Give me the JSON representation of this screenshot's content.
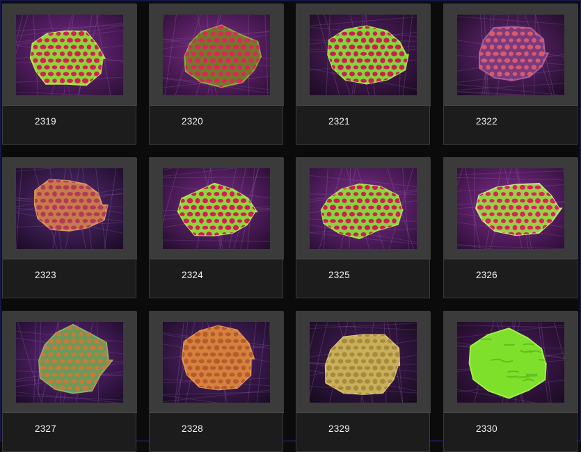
{
  "gallery": {
    "items": [
      {
        "label": "2319",
        "coral": {
          "base": "#8fd43a",
          "spot": "#d41f55",
          "rim": "#b8e44c",
          "bg": "#2a0f33",
          "tint": "#7a2a8c"
        }
      },
      {
        "label": "2320",
        "coral": {
          "base": "#6f7a2a",
          "spot": "#e2245a",
          "rim": "#98a640",
          "bg": "#2b0e34",
          "tint": "#82308e"
        }
      },
      {
        "label": "2321",
        "coral": {
          "base": "#84d43e",
          "spot": "#cc1d50",
          "rim": "#a8e24a",
          "bg": "#1a0b20",
          "tint": "#5e2270"
        }
      },
      {
        "label": "2322",
        "coral": {
          "base": "#7a3a7e",
          "spot": "#d85a6e",
          "rim": "#a35f98",
          "bg": "#1c0b24",
          "tint": "#6a2a7a"
        }
      },
      {
        "label": "2323",
        "coral": {
          "base": "#c87a4a",
          "spot": "#b13a5a",
          "rim": "#d89662",
          "bg": "#1a0a24",
          "tint": "#5a2e78"
        }
      },
      {
        "label": "2324",
        "coral": {
          "base": "#8ed63c",
          "spot": "#d21d55",
          "rim": "#b0e64c",
          "bg": "#220c2c",
          "tint": "#7c2d8a"
        }
      },
      {
        "label": "2325",
        "coral": {
          "base": "#88d43e",
          "spot": "#cf1e52",
          "rim": "#a9e14a",
          "bg": "#2a0f35",
          "tint": "#853094"
        }
      },
      {
        "label": "2326",
        "coral": {
          "base": "#9ad048",
          "spot": "#d82557",
          "rim": "#c3e682",
          "bg": "#2a0e33",
          "tint": "#872f94"
        }
      },
      {
        "label": "2327",
        "coral": {
          "base": "#6a9a58",
          "spot": "#c87a3a",
          "rim": "#8bb06a",
          "bg": "#1a0b26",
          "tint": "#6b2b86"
        }
      },
      {
        "label": "2328",
        "coral": {
          "base": "#d4823e",
          "spot": "#b85a2c",
          "rim": "#e29550",
          "bg": "#1a0b24",
          "tint": "#5a2874"
        }
      },
      {
        "label": "2329",
        "coral": {
          "base": "#c8b05a",
          "spot": "#a88a3e",
          "rim": "#d8c26c",
          "bg": "#150a1c",
          "tint": "#4a2060"
        }
      },
      {
        "label": "2330",
        "coral": {
          "base": "#7ee02a",
          "spot": "#5fbf1e",
          "rim": "#a4f048",
          "bg": "#1b0b22",
          "tint": "#4c1c5e"
        }
      }
    ]
  }
}
